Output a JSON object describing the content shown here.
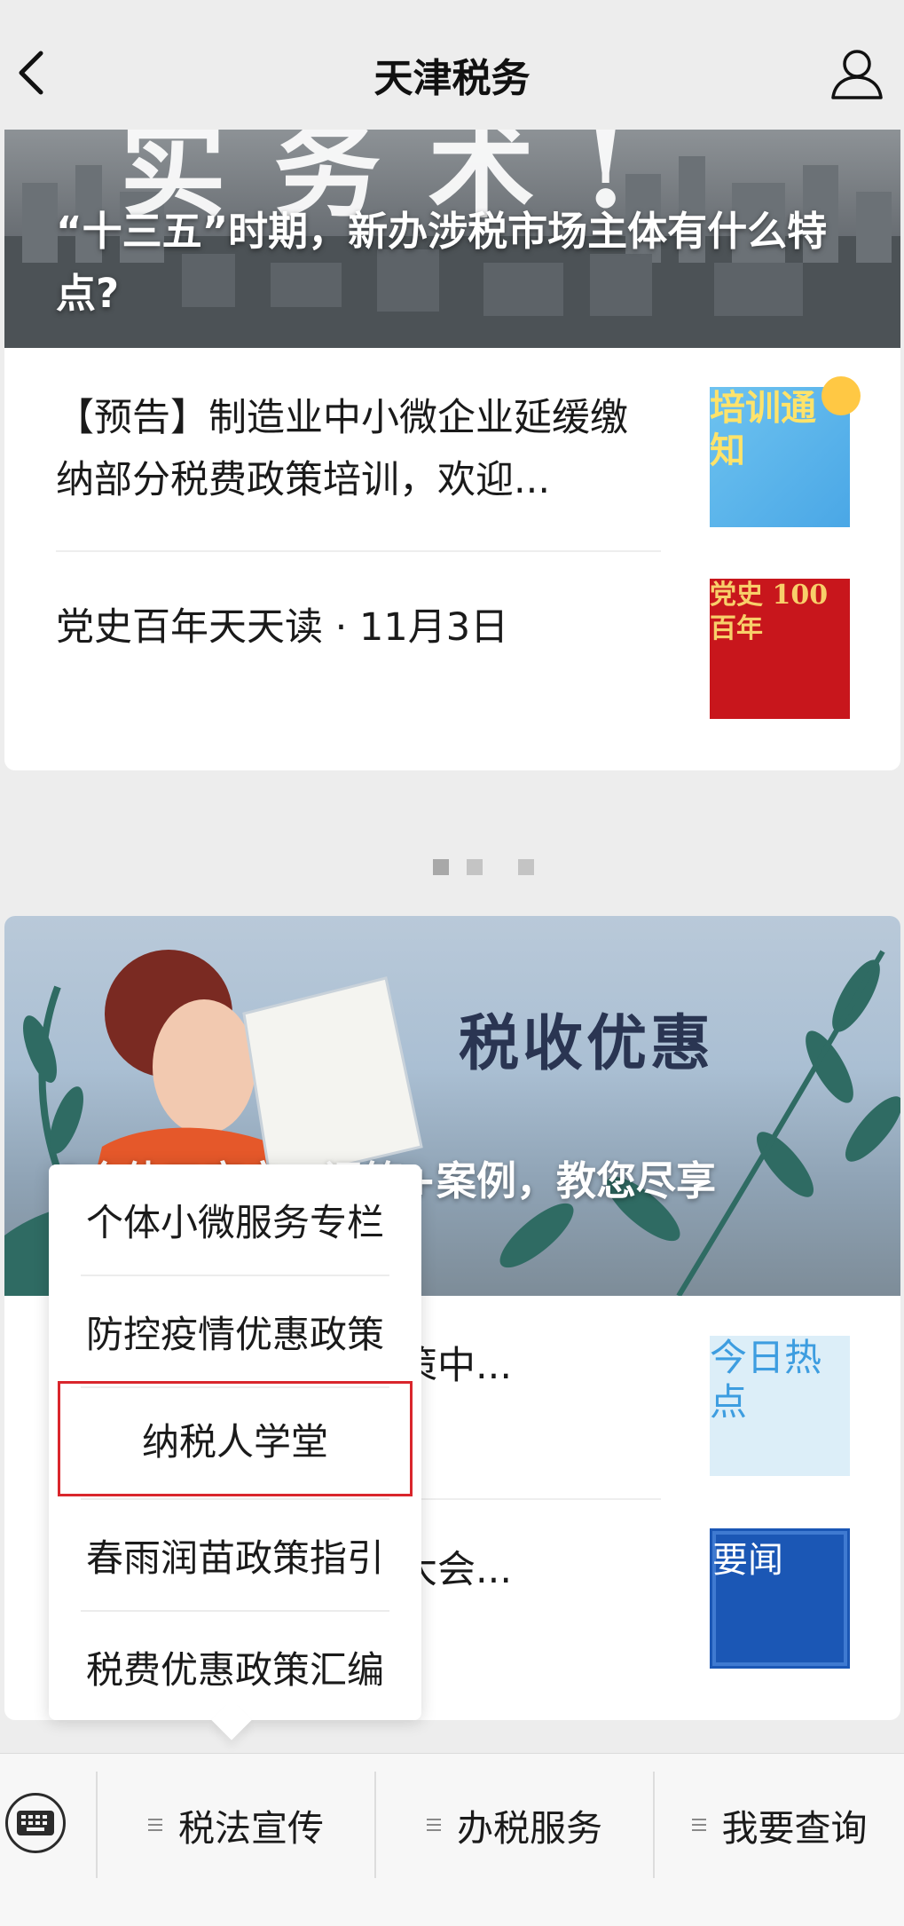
{
  "header": {
    "title": "天津税务"
  },
  "card1": {
    "hero_caption": "“十三五”时期，新办涉税市场主体有什么特点?",
    "items": [
      {
        "text": "【预告】制造业中小微企业延缓缴纳部分税费政策培训，欢迎...",
        "thumb_text": "培训通知"
      },
      {
        "text": "党史百年天天读 · 11月3日",
        "thumb_text": "党史 100 百年"
      }
    ]
  },
  "carousel": {
    "dots": 3,
    "active_index": 0
  },
  "card2": {
    "hero_heading": "税收优惠",
    "hero_caption": "3个体工商户一问答+案例，教您尽享",
    "items": [
      {
        "text": "中小微企业缓税费政策中...",
        "thumb_text": "今日热点"
      },
      {
        "text": "气候变化框架缔约方大会...",
        "thumb_text": "要闻"
      }
    ]
  },
  "popup_menu": {
    "items": [
      {
        "label": "个体小微服务专栏"
      },
      {
        "label": "防控疫情优惠政策"
      },
      {
        "label": "纳税人学堂",
        "highlighted": true
      },
      {
        "label": "春雨润苗政策指引"
      },
      {
        "label": "税费优惠政策汇编"
      }
    ]
  },
  "bottom_menu": {
    "tabs": [
      {
        "label": "税法宣传"
      },
      {
        "label": "办税服务"
      },
      {
        "label": "我要查询"
      }
    ]
  },
  "colors": {
    "highlight": "#d9262c",
    "background": "#ededed"
  }
}
